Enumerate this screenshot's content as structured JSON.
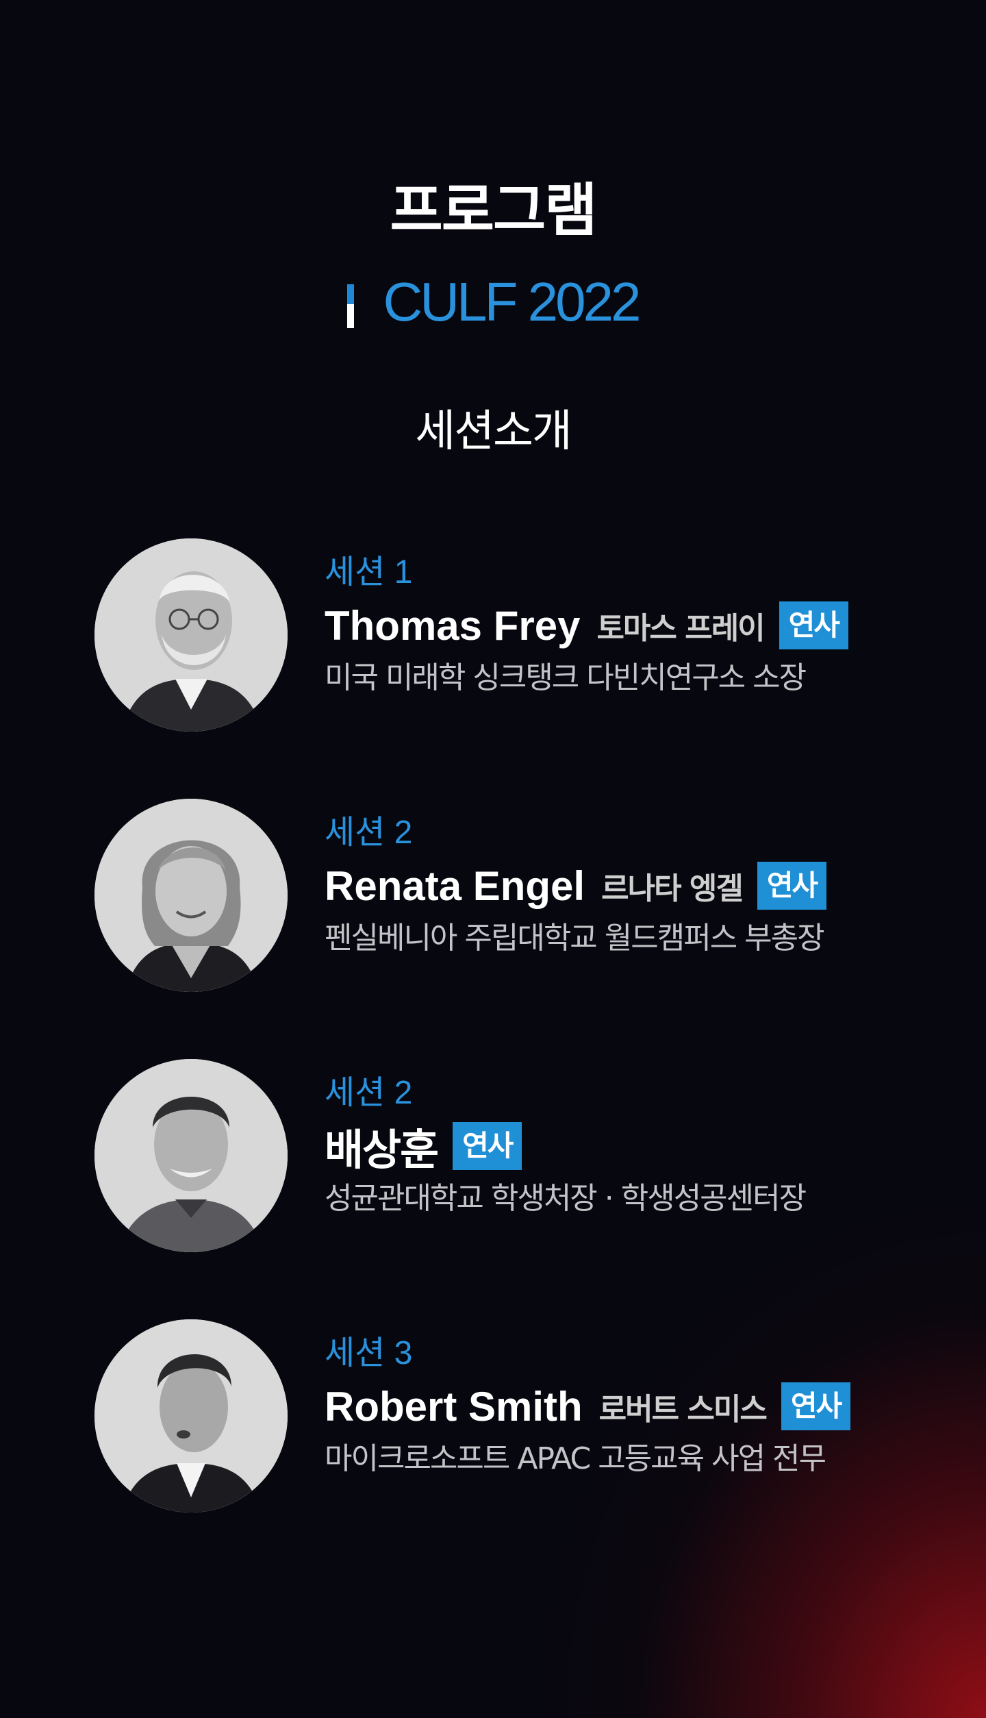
{
  "page_title": "프로그램",
  "event": {
    "name": "CULF 2022"
  },
  "section_heading": "세션소개",
  "colors": {
    "accent": "#2a92dc",
    "badge": "#1f8fd6",
    "background": "#07070f",
    "glow": "#960e16"
  },
  "speakers": [
    {
      "session": "세션 1",
      "name_en": "Thomas Frey",
      "name_ko": "토마스 프레이",
      "role": "연사",
      "description": "미국 미래학 싱크탱크 다빈치연구소 소장"
    },
    {
      "session": "세션 2",
      "name_en": "Renata Engel",
      "name_ko": "르나타 엥겔",
      "role": "연사",
      "description": "펜실베니아 주립대학교 월드캠퍼스 부총장"
    },
    {
      "session": "세션 2",
      "name_ko": "배상훈",
      "role": "연사",
      "description": "성균관대학교 학생처장 · 학생성공센터장"
    },
    {
      "session": "세션 3",
      "name_en": "Robert Smith",
      "name_ko": "로버트 스미스",
      "role": "연사",
      "description": "마이크로소프트 APAC 고등교육 사업 전무"
    }
  ]
}
